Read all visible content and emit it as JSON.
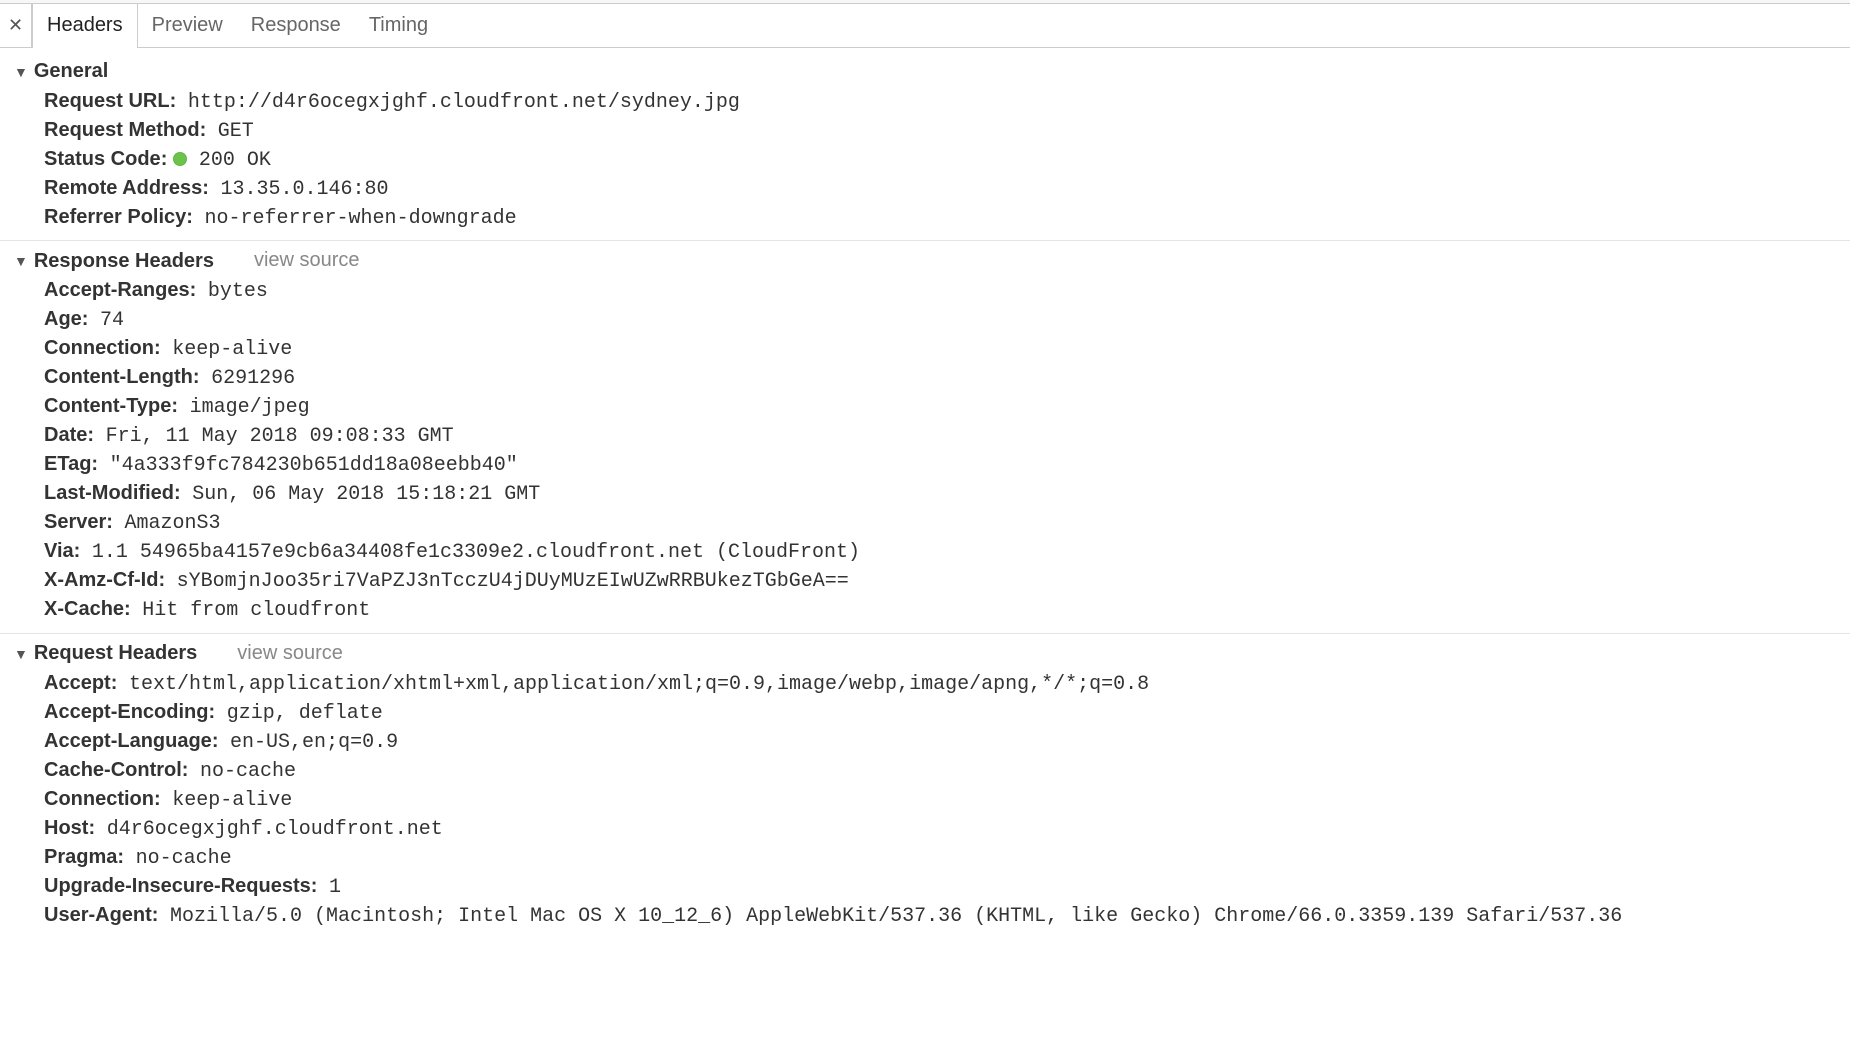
{
  "tabs": {
    "headers": "Headers",
    "preview": "Preview",
    "response": "Response",
    "timing": "Timing"
  },
  "sections": {
    "general": {
      "title": "General",
      "items": [
        {
          "label": "Request URL",
          "value": "http://d4r6ocegxjghf.cloudfront.net/sydney.jpg",
          "mono": true
        },
        {
          "label": "Request Method",
          "value": "GET",
          "mono": true
        },
        {
          "label": "Status Code",
          "value": "200 OK",
          "mono": true,
          "status_dot": true
        },
        {
          "label": "Remote Address",
          "value": "13.35.0.146:80",
          "mono": true
        },
        {
          "label": "Referrer Policy",
          "value": "no-referrer-when-downgrade",
          "mono": true
        }
      ]
    },
    "response_headers": {
      "title": "Response Headers",
      "view_source": "view source",
      "items": [
        {
          "label": "Accept-Ranges",
          "value": "bytes",
          "mono": true
        },
        {
          "label": "Age",
          "value": "74",
          "mono": true
        },
        {
          "label": "Connection",
          "value": "keep-alive",
          "mono": true
        },
        {
          "label": "Content-Length",
          "value": "6291296",
          "mono": true
        },
        {
          "label": "Content-Type",
          "value": "image/jpeg",
          "mono": true
        },
        {
          "label": "Date",
          "value": "Fri, 11 May 2018 09:08:33 GMT",
          "mono": true
        },
        {
          "label": "ETag",
          "value": "\"4a333f9fc784230b651dd18a08eebb40\"",
          "mono": true
        },
        {
          "label": "Last-Modified",
          "value": "Sun, 06 May 2018 15:18:21 GMT",
          "mono": true
        },
        {
          "label": "Server",
          "value": "AmazonS3",
          "mono": true
        },
        {
          "label": "Via",
          "value": "1.1 54965ba4157e9cb6a34408fe1c3309e2.cloudfront.net (CloudFront)",
          "mono": true
        },
        {
          "label": "X-Amz-Cf-Id",
          "value": "sYBomjnJoo35ri7VaPZJ3nTcczU4jDUyMUzEIwUZwRRBUkezTGbGeA==",
          "mono": true
        },
        {
          "label": "X-Cache",
          "value": "Hit from cloudfront",
          "mono": true
        }
      ]
    },
    "request_headers": {
      "title": "Request Headers",
      "view_source": "view source",
      "items": [
        {
          "label": "Accept",
          "value": "text/html,application/xhtml+xml,application/xml;q=0.9,image/webp,image/apng,*/*;q=0.8",
          "mono": true
        },
        {
          "label": "Accept-Encoding",
          "value": "gzip, deflate",
          "mono": true
        },
        {
          "label": "Accept-Language",
          "value": "en-US,en;q=0.9",
          "mono": true
        },
        {
          "label": "Cache-Control",
          "value": "no-cache",
          "mono": true
        },
        {
          "label": "Connection",
          "value": "keep-alive",
          "mono": true
        },
        {
          "label": "Host",
          "value": "d4r6ocegxjghf.cloudfront.net",
          "mono": true
        },
        {
          "label": "Pragma",
          "value": "no-cache",
          "mono": true
        },
        {
          "label": "Upgrade-Insecure-Requests",
          "value": "1",
          "mono": true
        },
        {
          "label": "User-Agent",
          "value": "Mozilla/5.0 (Macintosh; Intel Mac OS X 10_12_6) AppleWebKit/537.36 (KHTML, like Gecko) Chrome/66.0.3359.139 Safari/537.36",
          "mono": true
        }
      ]
    }
  }
}
